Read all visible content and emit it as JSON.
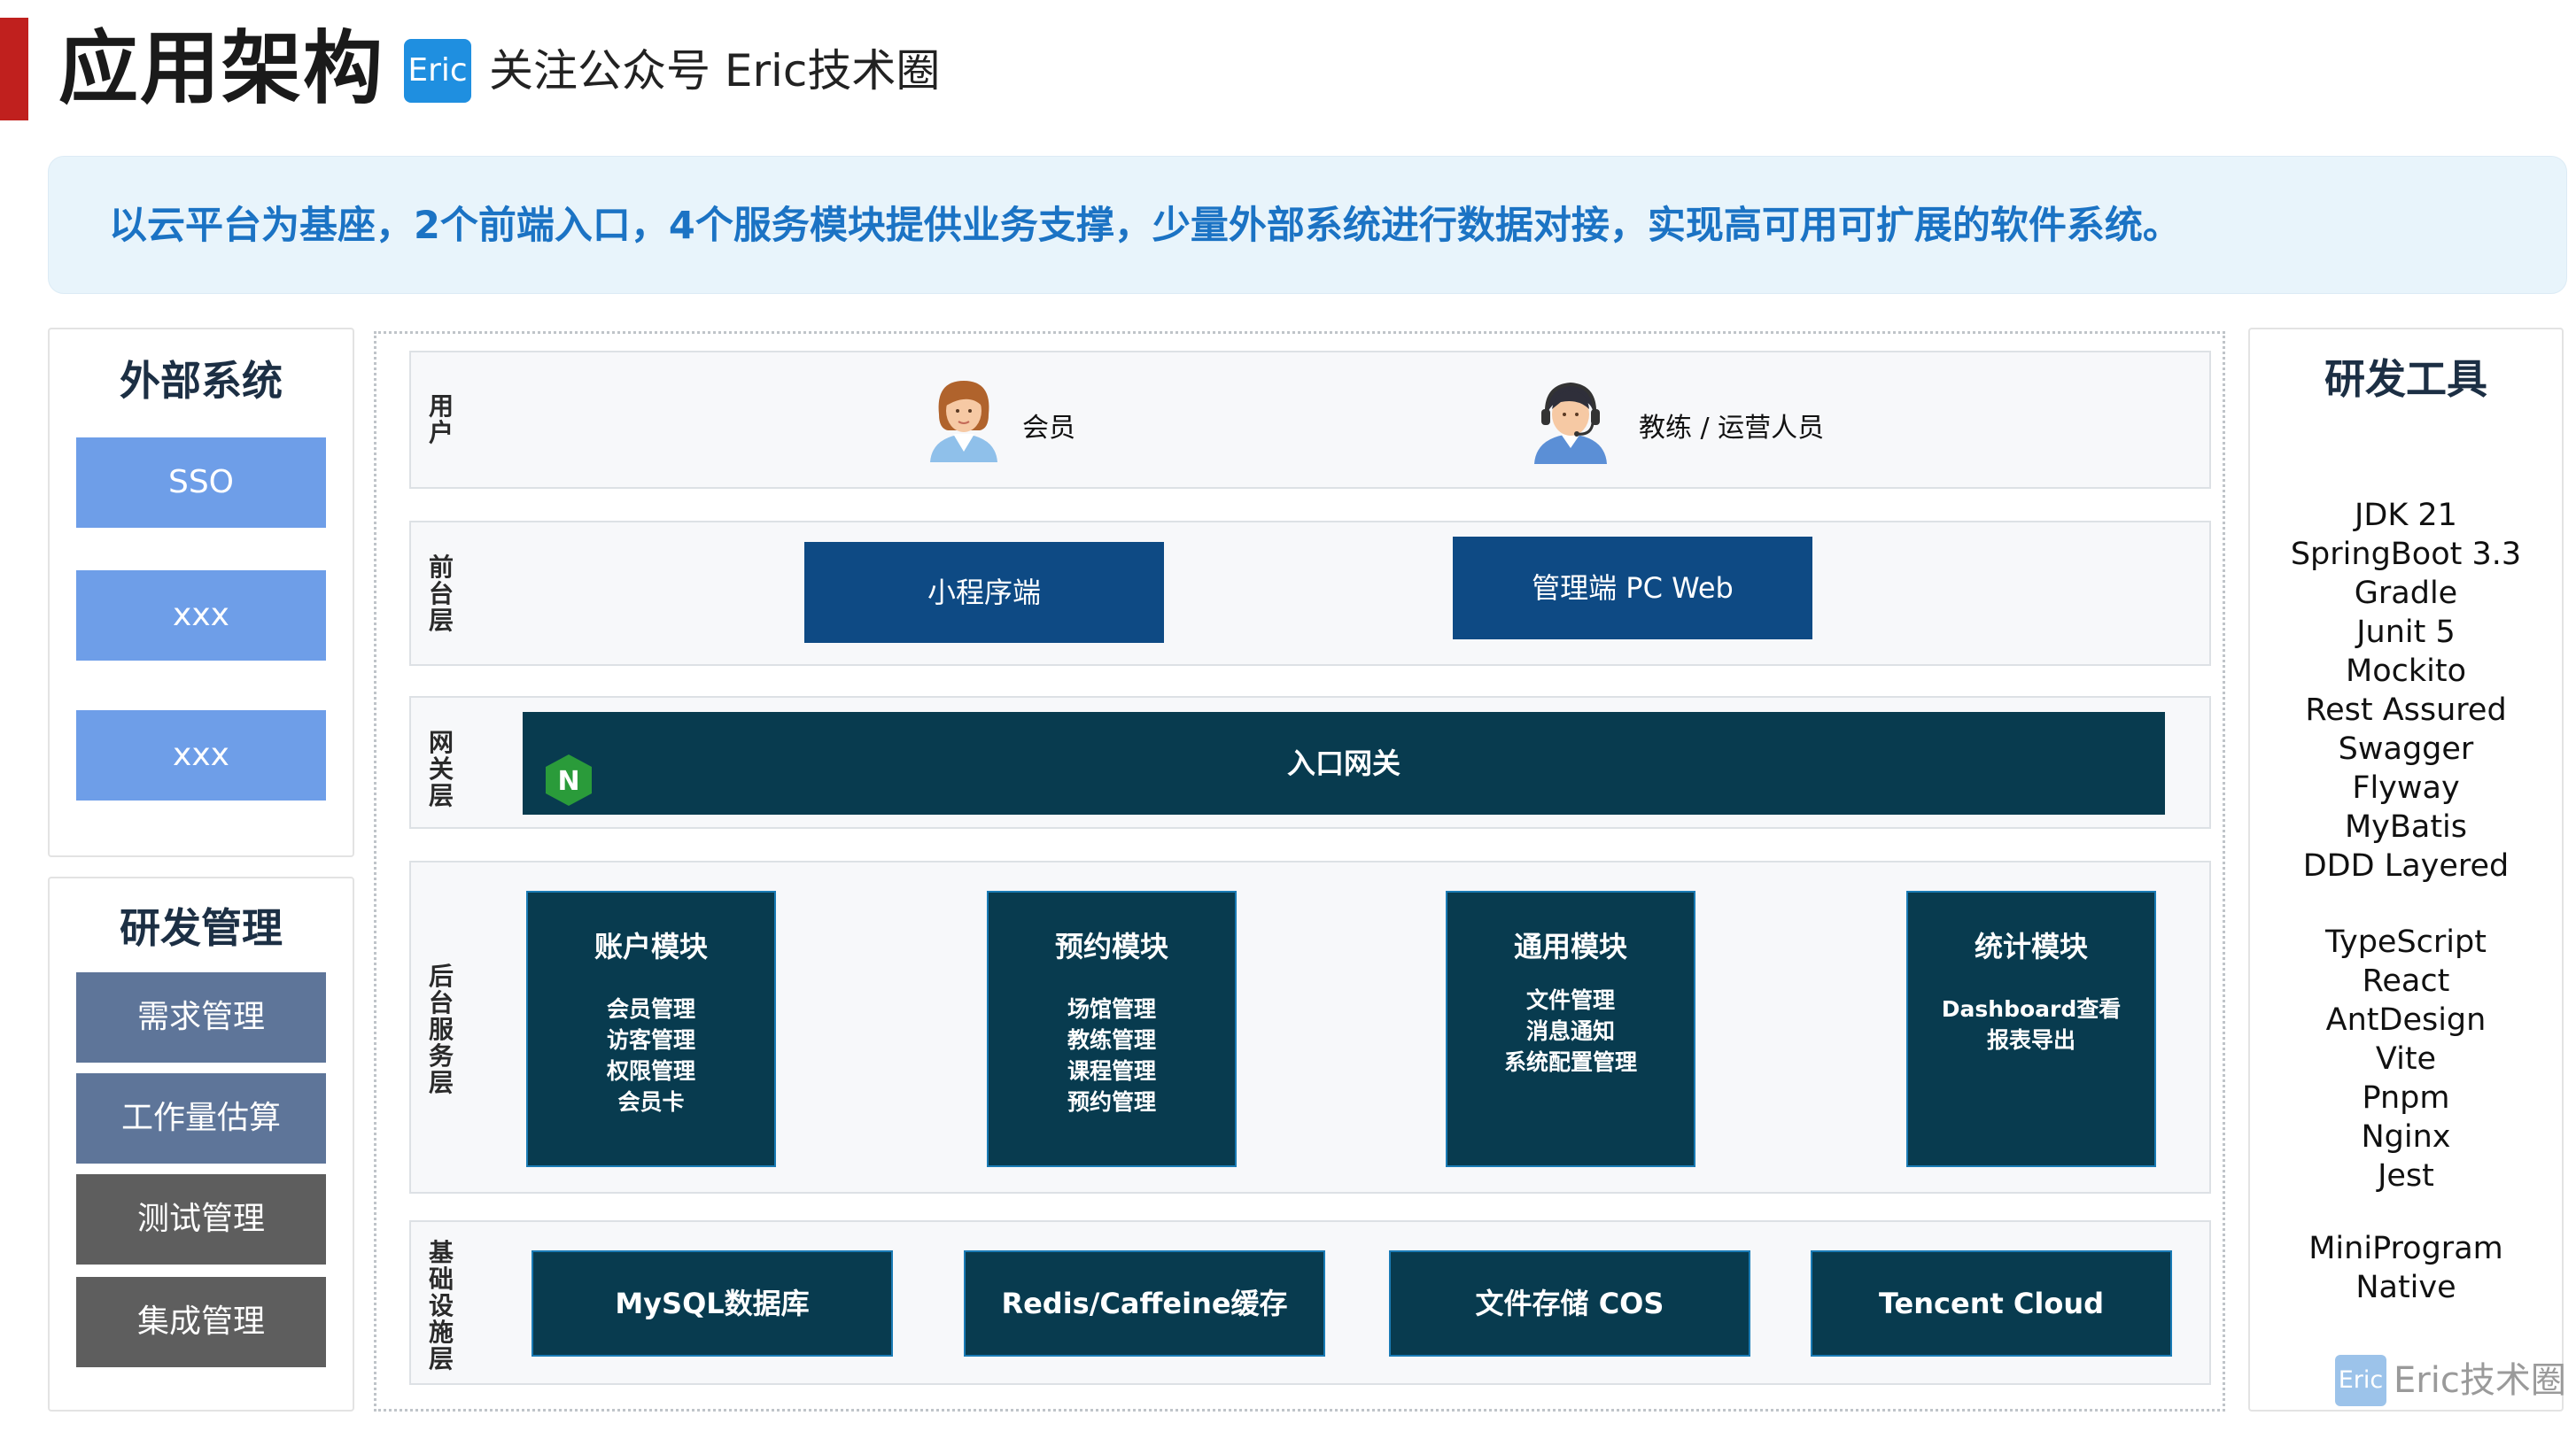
{
  "header": {
    "title": "应用架构",
    "badge": "Eric",
    "subtitle": "关注公众号 Eric技术圈",
    "accent_color": "#c0201e"
  },
  "summary": {
    "text": "以云平台为基座，2个前端入口，4个服务模块提供业务支撑，少量外部系统进行数据对接，实现高可用可扩展的软件系统。"
  },
  "external_systems": {
    "title": "外部系统",
    "items": [
      "SSO",
      "xxx",
      "xxx"
    ],
    "color": "#6e9ee8"
  },
  "dev_management": {
    "title": "研发管理",
    "items": [
      {
        "label": "需求管理",
        "color": "#5e7599"
      },
      {
        "label": "工作量估算",
        "color": "#5e7599"
      },
      {
        "label": "测试管理",
        "color": "#5e5e5e"
      },
      {
        "label": "集成管理",
        "color": "#5e5e5e"
      }
    ]
  },
  "layers": {
    "user": {
      "label": "用户",
      "actors": [
        {
          "name": "会员",
          "icon": "member-avatar-icon"
        },
        {
          "name": "教练 / 运营人员",
          "icon": "operator-headset-avatar-icon"
        }
      ]
    },
    "frontend": {
      "label": "前台层",
      "items": [
        "小程序端",
        "管理端 PC Web"
      ]
    },
    "gateway": {
      "label": "网关层",
      "icon": "nginx-icon",
      "icon_letter": "N",
      "title": "入口网关"
    },
    "backend": {
      "label": "后台服务层",
      "modules": [
        {
          "name": "账户模块",
          "items": [
            "会员管理",
            "访客管理",
            "权限管理",
            "会员卡"
          ]
        },
        {
          "name": "预约模块",
          "items": [
            "场馆管理",
            "教练管理",
            "课程管理",
            "预约管理"
          ]
        },
        {
          "name": "通用模块",
          "items": [
            "文件管理",
            "消息通知",
            "系统配置管理"
          ]
        },
        {
          "name": "统计模块",
          "items": [
            "Dashboard查看",
            "报表导出"
          ]
        }
      ]
    },
    "infrastructure": {
      "label": "基础设施层",
      "items": [
        "MySQL数据库",
        "Redis/Caffeine缓存",
        "文件存储 COS",
        "Tencent Cloud"
      ]
    }
  },
  "dev_tools": {
    "title": "研发工具",
    "groups": [
      [
        "JDK 21",
        "SpringBoot 3.3",
        "Gradle",
        "Junit 5",
        "Mockito",
        "Rest Assured",
        "Swagger",
        "Flyway",
        "MyBatis",
        "DDD Layered"
      ],
      [
        "TypeScript",
        "React",
        "AntDesign",
        "Vite",
        "Pnpm",
        "Nginx",
        "Jest"
      ],
      [
        "MiniProgram",
        "Native"
      ]
    ]
  },
  "watermark": {
    "badge": "Eric",
    "text": "Eric技术圈"
  }
}
